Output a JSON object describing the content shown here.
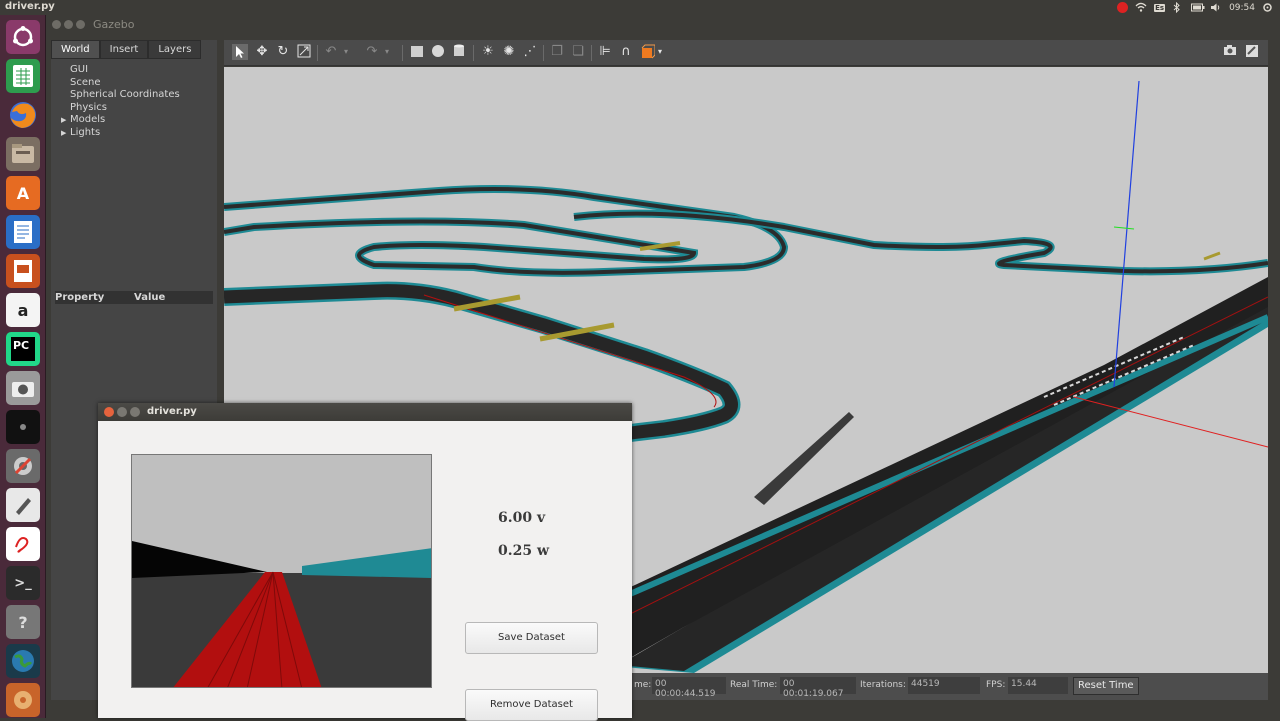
{
  "top_panel": {
    "title": "driver.py",
    "keyboard_layout": "Es",
    "clock": "09:54"
  },
  "launcher": {
    "items": [
      "ubuntu-dash",
      "libreoffice-calc",
      "firefox",
      "files",
      "software-center",
      "libreoffice-writer",
      "libreoffice-impress",
      "amazon",
      "pycharm",
      "screenshot",
      "gnome-terminal-dark",
      "system-settings",
      "text-editor",
      "document-viewer",
      "terminal",
      "help",
      "earth",
      "disk"
    ]
  },
  "gazebo": {
    "window_title": "Gazebo",
    "tabs": [
      "World",
      "Insert",
      "Layers"
    ],
    "tree": [
      {
        "label": "GUI",
        "expandable": false
      },
      {
        "label": "Scene",
        "expandable": false
      },
      {
        "label": "Spherical Coordinates",
        "expandable": false
      },
      {
        "label": "Physics",
        "expandable": false
      },
      {
        "label": "Models",
        "expandable": true
      },
      {
        "label": "Lights",
        "expandable": true
      }
    ],
    "property_header": {
      "property": "Property",
      "value": "Value"
    },
    "bottom_bar": {
      "sim_time_label": "me:",
      "sim_time": "00 00:00:44.519",
      "real_time_label": "Real Time:",
      "real_time": "00 00:01:19.067",
      "iterations_label": "Iterations:",
      "iterations": "44519",
      "fps_label": "FPS:",
      "fps": "15.44",
      "reset_label": "Reset Time"
    }
  },
  "driver": {
    "title": "driver.py",
    "v_readout": "6.00 v",
    "w_readout": "0.25 w",
    "save_label": "Save Dataset",
    "remove_label": "Remove Dataset"
  },
  "colors": {
    "track_edge": "#1e8a94",
    "track_surface": "#2a2a2a",
    "ground": "#c8c8c8",
    "red_line": "#c41010"
  }
}
